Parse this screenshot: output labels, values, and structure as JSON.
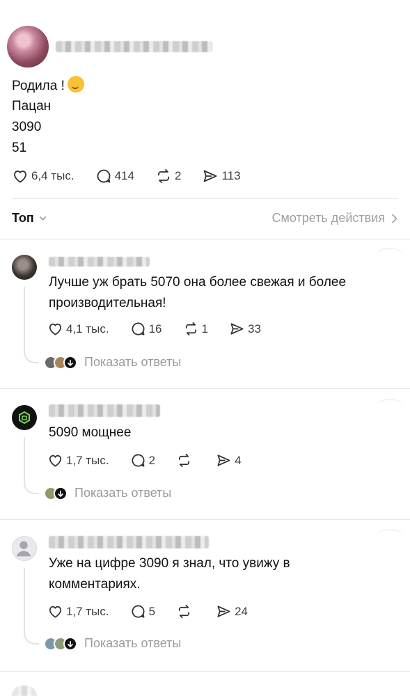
{
  "post": {
    "lines": [
      "Родила !",
      "Пацан",
      "3090",
      "51"
    ],
    "emoji": "partying-face-icon",
    "likes": "6,4 тыс.",
    "comments": "414",
    "reposts": "2",
    "shares": "113"
  },
  "sort": {
    "label": "Топ",
    "view_activity": "Смотреть действия"
  },
  "comments": [
    {
      "text": "Лучше уж брать 5070 она более свежая и более производительная!",
      "likes": "4,1 тыс.",
      "replies": "16",
      "reposts": "1",
      "shares": "33",
      "show_replies": "Показать ответы"
    },
    {
      "text": "5090 мощнее",
      "likes": "1,7 тыс.",
      "replies": "2",
      "reposts": "",
      "shares": "4",
      "show_replies": "Показать ответы"
    },
    {
      "text": "Уже на цифре 3090 я знал, что увижу в комментариях.",
      "likes": "1,7 тыс.",
      "replies": "5",
      "reposts": "",
      "shares": "24",
      "show_replies": "Показать ответы"
    }
  ],
  "colors": {
    "text": "#101010",
    "muted": "#9a9a9a",
    "divider": "#e5e5e5",
    "icon": "#3c3c3c"
  }
}
